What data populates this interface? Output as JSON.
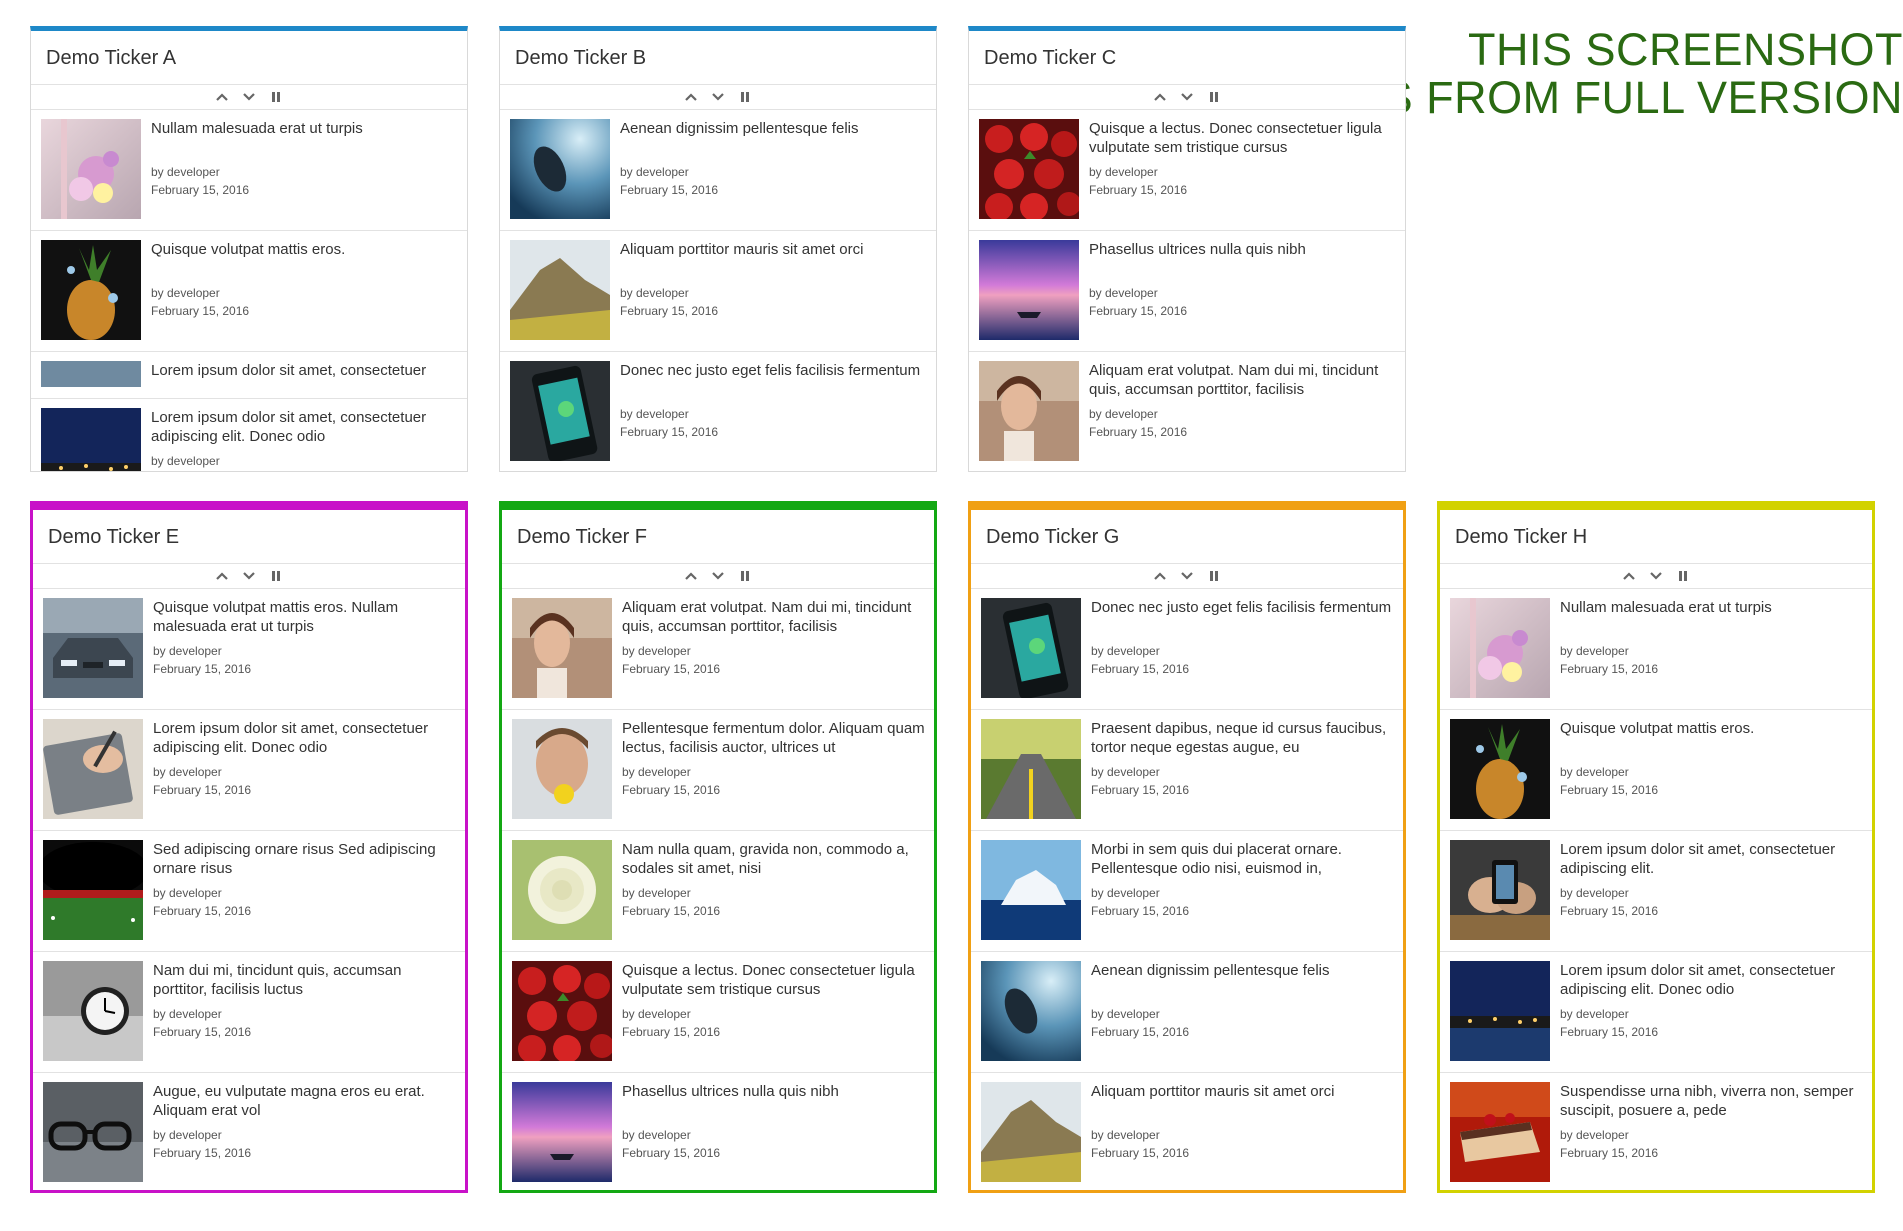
{
  "banner": {
    "line1": "THIS SCREENSHOT",
    "line2": "IS FROM FULL VERSION"
  },
  "tickers": [
    {
      "title": "Demo Ticker A",
      "accent": "#1e88c8",
      "items": [
        {
          "title": "Nullam malesuada erat ut turpis",
          "author": "by developer",
          "date": "February 15, 2016",
          "image": "flowers-jar"
        },
        {
          "title": "Quisque volutpat mattis eros.",
          "author": "by developer",
          "date": "February 15, 2016",
          "image": "pineapple-splash"
        },
        {
          "title": "Lorem ipsum dolor sit amet, consectetuer",
          "author": "",
          "date": "",
          "image": "boat-strip"
        },
        {
          "title": "Lorem ipsum dolor sit amet, consectetuer adipiscing elit. Donec odio",
          "author": "by developer",
          "date": "",
          "image": "night-harbor"
        }
      ]
    },
    {
      "title": "Demo Ticker B",
      "accent": "#1e88c8",
      "items": [
        {
          "title": "Aenean dignissim pellentesque felis",
          "author": "by developer",
          "date": "February 15, 2016",
          "image": "underwater-diver"
        },
        {
          "title": "Aliquam porttitor mauris sit amet orci",
          "author": "by developer",
          "date": "February 15, 2016",
          "image": "mountain-field"
        },
        {
          "title": "Donec nec justo eget felis facilisis fermentum",
          "author": "by developer",
          "date": "February 15, 2016",
          "image": "phone-whatsapp"
        }
      ]
    },
    {
      "title": "Demo Ticker C",
      "accent": "#1e88c8",
      "items": [
        {
          "title": "Quisque a lectus. Donec consectetuer ligula vulputate sem tristique cursus",
          "author": "by developer",
          "date": "February 15, 2016",
          "image": "strawberries"
        },
        {
          "title": "Phasellus ultrices nulla quis nibh",
          "author": "by developer",
          "date": "February 15, 2016",
          "image": "purple-sunset-boat"
        },
        {
          "title": "Aliquam erat volutpat. Nam dui mi, tincidunt quis, accumsan porttitor, facilisis",
          "author": "by developer",
          "date": "February 15, 2016",
          "image": "woman-portrait"
        }
      ]
    },
    {
      "title": "Demo Ticker E",
      "accent": "#c812c8",
      "items": [
        {
          "title": "Quisque volutpat mattis eros. Nullam malesuada erat ut turpis",
          "author": "by developer",
          "date": "February 15, 2016",
          "image": "car-front"
        },
        {
          "title": "Lorem ipsum dolor sit amet, consectetuer adipiscing elit. Donec odio",
          "author": "by developer",
          "date": "February 15, 2016",
          "image": "tablet-stylus"
        },
        {
          "title": "Sed adipiscing ornare risus Sed adipiscing ornare risus",
          "author": "by developer",
          "date": "February 15, 2016",
          "image": "stadium"
        },
        {
          "title": "Nam dui mi, tincidunt quis, accumsan porttitor, facilisis luctus",
          "author": "by developer",
          "date": "February 15, 2016",
          "image": "alarm-clock"
        },
        {
          "title": "Augue, eu vulputate magna eros eu erat. Aliquam erat vol",
          "author": "by developer",
          "date": "February 15, 2016",
          "image": "eyeglasses"
        }
      ]
    },
    {
      "title": "Demo Ticker F",
      "accent": "#13a813",
      "items": [
        {
          "title": "Aliquam erat volutpat. Nam dui mi, tincidunt quis, accumsan porttitor, facilisis",
          "author": "by developer",
          "date": "February 15, 2016",
          "image": "woman-portrait"
        },
        {
          "title": "Pellentesque fermentum dolor. Aliquam quam lectus, facilisis auctor, ultrices ut",
          "author": "by developer",
          "date": "February 15, 2016",
          "image": "man-lemon"
        },
        {
          "title": "Nam nulla quam, gravida non, commodo a, sodales sit amet, nisi",
          "author": "by developer",
          "date": "February 15, 2016",
          "image": "white-rose"
        },
        {
          "title": "Quisque a lectus. Donec consectetuer ligula vulputate sem tristique cursus",
          "author": "by developer",
          "date": "February 15, 2016",
          "image": "strawberries"
        },
        {
          "title": "Phasellus ultrices nulla quis nibh",
          "author": "by developer",
          "date": "February 15, 2016",
          "image": "purple-sunset-boat"
        }
      ]
    },
    {
      "title": "Demo Ticker G",
      "accent": "#f0a014",
      "items": [
        {
          "title": "Donec nec justo eget felis facilisis fermentum",
          "author": "by developer",
          "date": "February 15, 2016",
          "image": "phone-whatsapp"
        },
        {
          "title": "Praesent dapibus, neque id cursus faucibus, tortor neque egestas augue, eu",
          "author": "by developer",
          "date": "February 15, 2016",
          "image": "forest-road"
        },
        {
          "title": "Morbi in sem quis dui placerat ornare. Pellentesque odio nisi, euismod in,",
          "author": "by developer",
          "date": "February 15, 2016",
          "image": "iceberg"
        },
        {
          "title": "Aenean dignissim pellentesque felis",
          "author": "by developer",
          "date": "February 15, 2016",
          "image": "underwater-diver"
        },
        {
          "title": "Aliquam porttitor mauris sit amet orci",
          "author": "by developer",
          "date": "February 15, 2016",
          "image": "mountain-field"
        }
      ]
    },
    {
      "title": "Demo Ticker H",
      "accent": "#d2d200",
      "items": [
        {
          "title": "Nullam malesuada erat ut turpis",
          "author": "by developer",
          "date": "February 15, 2016",
          "image": "flowers-jar"
        },
        {
          "title": "Quisque volutpat mattis eros.",
          "author": "by developer",
          "date": "February 15, 2016",
          "image": "pineapple-splash"
        },
        {
          "title": "Lorem ipsum dolor sit amet, consectetuer adipiscing elit.",
          "author": "by developer",
          "date": "February 15, 2016",
          "image": "phone-hands"
        },
        {
          "title": "Lorem ipsum dolor sit amet, consectetuer adipiscing elit. Donec odio",
          "author": "by developer",
          "date": "February 15, 2016",
          "image": "night-harbor"
        },
        {
          "title": "Suspendisse urna nibh, viverra non, semper suscipit, posuere a, pede",
          "author": "by developer",
          "date": "February 15, 2016",
          "image": "cake-slice"
        }
      ]
    }
  ]
}
